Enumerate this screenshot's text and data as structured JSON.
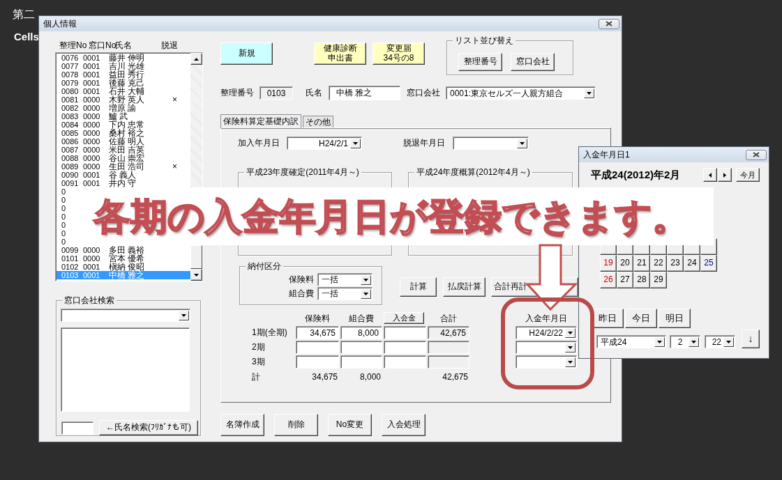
{
  "desktop": {
    "title": "第二",
    "subtitle": "Cells"
  },
  "main_window": {
    "title": "個人情報",
    "list_headers": [
      "整理No",
      "窓口No",
      "氏名",
      "脱退"
    ],
    "list_rows": [
      {
        "no": "0076",
        "window_no": "0001",
        "name": "藤井 伸明",
        "selected": false
      },
      {
        "no": "0077",
        "window_no": "0001",
        "name": "吉川 光雄",
        "selected": false
      },
      {
        "no": "0078",
        "window_no": "0001",
        "name": "益田 秀行",
        "selected": false
      },
      {
        "no": "0079",
        "window_no": "0001",
        "name": "後藤 克己",
        "selected": false
      },
      {
        "no": "0080",
        "window_no": "0001",
        "name": "石井 大輔",
        "selected": false
      },
      {
        "no": "0081",
        "window_no": "0000",
        "name": "木野 英人",
        "withdrawn": "×",
        "selected": false
      },
      {
        "no": "0082",
        "window_no": "0000",
        "name": "増原 諭",
        "selected": false
      },
      {
        "no": "0083",
        "window_no": "0000",
        "name": "鱸 武",
        "selected": false
      },
      {
        "no": "0084",
        "window_no": "0000",
        "name": "下内 忠常",
        "selected": false
      },
      {
        "no": "0085",
        "window_no": "0000",
        "name": "桑村 裕之",
        "selected": false
      },
      {
        "no": "0086",
        "window_no": "0000",
        "name": "佐藤 明人",
        "selected": false
      },
      {
        "no": "0087",
        "window_no": "0000",
        "name": "米田 吉英",
        "selected": false
      },
      {
        "no": "0088",
        "window_no": "0000",
        "name": "谷山 崇宏",
        "selected": false
      },
      {
        "no": "0089",
        "window_no": "0000",
        "name": "生田 浩司",
        "withdrawn": "×",
        "selected": false
      },
      {
        "no": "0090",
        "window_no": "0001",
        "name": "谷 義人",
        "selected": false
      },
      {
        "no": "0091",
        "window_no": "0001",
        "name": "井内 守",
        "selected": false
      },
      {
        "no": "0",
        "selected": false
      },
      {
        "no": "0",
        "selected": false
      },
      {
        "no": "0",
        "selected": false
      },
      {
        "no": "0",
        "selected": false
      },
      {
        "no": "0",
        "selected": false
      },
      {
        "no": "0",
        "selected": false
      },
      {
        "no": "0",
        "selected": false
      },
      {
        "no": "0099",
        "window_no": "0000",
        "name": "多田 義裕",
        "selected": false
      },
      {
        "no": "0101",
        "window_no": "0000",
        "name": "宮本 優希",
        "selected": false
      },
      {
        "no": "0102",
        "window_no": "0001",
        "name": "槇納 俊昭",
        "selected": false
      },
      {
        "no": "0103",
        "window_no": "0001",
        "name": "中橋 雅之",
        "selected": true
      }
    ],
    "company_search": {
      "legend": "窓口会社検索",
      "name_search_button": "←氏名検索(ﾌﾘｶﾞﾅも可)"
    },
    "header_buttons": [
      {
        "lines": [
          "新規"
        ],
        "color": "#ccffff"
      },
      {
        "lines": [
          "健康診断",
          "申出書"
        ],
        "color": "#ffffc0"
      },
      {
        "lines": [
          "変更届",
          "34号の8"
        ],
        "color": "#ffffc0"
      }
    ],
    "sort_group": {
      "legend": "リスト並び替え",
      "buttons": [
        "整理番号",
        "窓口会社"
      ]
    },
    "record": {
      "number_label": "整理番号",
      "number": "0103",
      "name_label": "氏名",
      "name": "中橋 雅之",
      "company_label": "窓口会社",
      "company": "0001:東京セルズ一人親方組合"
    },
    "tabs": [
      {
        "label": "保険料算定基礎内訳",
        "selected": true
      },
      {
        "label": "その他",
        "selected": false
      }
    ],
    "dates": {
      "join_label": "加入年月日",
      "join_date": "H24/2/1",
      "leave_label": "脱退年月日"
    },
    "year_groups": [
      "平成23年度確定(2011年4月～)",
      "平成24年度概算(2012年4月～)"
    ],
    "payment_type": {
      "legend": "納付区分",
      "rows": [
        {
          "label": "保険料",
          "value": "一括"
        },
        {
          "label": "組合費",
          "value": "一括"
        }
      ]
    },
    "calc_buttons": [
      "計算",
      "払戻計算",
      "合計再計"
    ],
    "amounts": {
      "columns": [
        {
          "label": "保険料",
          "kind": "text"
        },
        {
          "label": "組合費",
          "kind": "text"
        },
        {
          "label": "入会金",
          "kind": "button"
        },
        {
          "label": "合計",
          "kind": "text"
        }
      ],
      "rows": [
        {
          "label": "1期(全期)",
          "payment_date": "H24/2/22",
          "cells": [
            {
              "kind": "input",
              "value": "34,675"
            },
            {
              "kind": "input",
              "value": "8,000"
            },
            {
              "kind": "input"
            },
            {
              "kind": "readonly",
              "value": "42,675"
            }
          ]
        },
        {
          "label": "2期",
          "cells": [
            {
              "kind": "input"
            },
            {
              "kind": "input"
            },
            {
              "kind": "input"
            },
            {
              "kind": "readonly"
            }
          ]
        },
        {
          "label": "3期",
          "cells": [
            {
              "kind": "input"
            },
            {
              "kind": "input"
            },
            {
              "kind": "input"
            },
            {
              "kind": "readonly"
            }
          ]
        }
      ],
      "total": {
        "label": "計",
        "values": [
          {
            "kind": "amount",
            "value": "34,675"
          },
          {
            "kind": "amount",
            "value": "8,000"
          },
          {
            "kind": "blank"
          },
          {
            "kind": "amount",
            "value": "42,675"
          }
        ]
      },
      "payment_date_label": "入金年月日"
    },
    "bottom_buttons": [
      "名簿作成",
      "削除",
      "No変更",
      "入会処理"
    ]
  },
  "calendar_window": {
    "title": "入金年月日1",
    "heading": "平成24(2012)年2月",
    "this_month_button": "今月",
    "weeks": [
      [
        {
          "day": "19",
          "color": "#cc0000"
        },
        {
          "day": "20",
          "color": "#000000"
        },
        {
          "day": "21",
          "color": "#000000"
        },
        {
          "day": "22",
          "color": "#000000"
        },
        {
          "day": "23",
          "color": "#000000"
        },
        {
          "day": "24",
          "color": "#000000"
        },
        {
          "day": "25",
          "color": "#000099"
        }
      ],
      [
        {
          "day": "26",
          "color": "#cc0000"
        },
        {
          "day": "27",
          "color": "#000000"
        },
        {
          "day": "28",
          "color": "#000000"
        },
        {
          "day": "29",
          "color": "#000000"
        }
      ]
    ],
    "day_buttons": [
      "昨日",
      "今日",
      "明日"
    ],
    "selects": [
      "平成24",
      "2",
      "22"
    ],
    "apply_button": "↓"
  },
  "overlay": {
    "caption": "各期の入金年月日が登録できます。"
  }
}
